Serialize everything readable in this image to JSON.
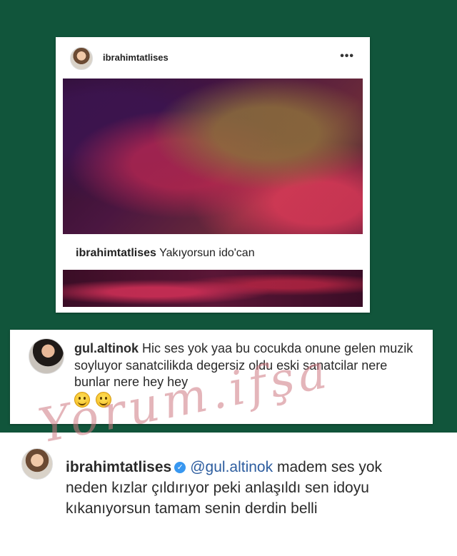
{
  "post": {
    "username": "ibrahimtatlises",
    "more_icon": "more-horizontal-icon",
    "caption_user": "ibrahimtatlises",
    "caption_text": "Yakıyorsun ido'can"
  },
  "comment": {
    "username": "gul.altinok",
    "text": "Hic ses yok yaa bu cocukda onune gelen muzik soyluyor sanatcilikda degersiz oldu eski sanatcilar nere bunlar nere hey hey",
    "emojis": [
      "grinning-face-icon",
      "grinning-face-icon"
    ]
  },
  "reply": {
    "username": "ibrahimtatlises",
    "verified_icon": "verified-badge-icon",
    "mention": "@gul.altinok",
    "text": "madem ses yok neden kızlar çıldırıyor peki anlaşıldı sen idoyu kıkanıyorsun tamam senin derdin belli"
  },
  "watermark": "Yorum.ifşa",
  "colors": {
    "background": "#11553b",
    "card": "#ffffff",
    "mention": "#2d5d9f",
    "verified": "#3897f0",
    "watermark": "#cd7882"
  }
}
